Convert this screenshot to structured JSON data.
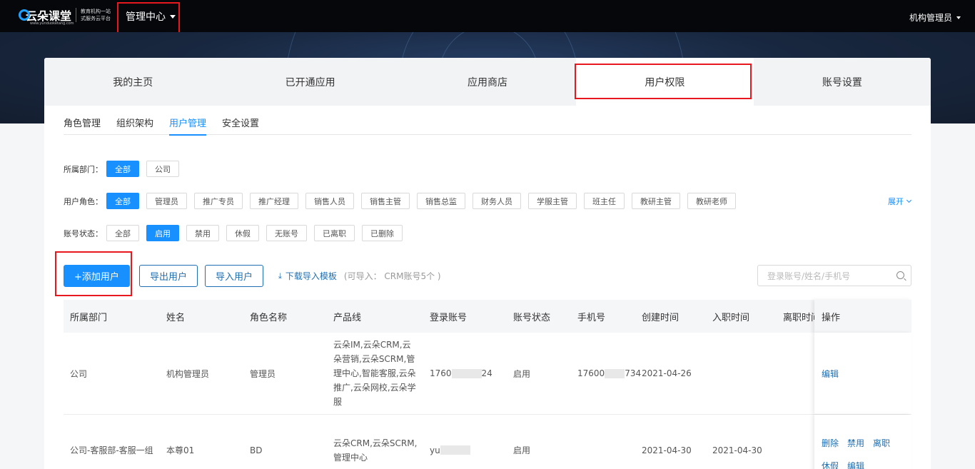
{
  "topbar": {
    "logo_title": "云朵课堂",
    "logo_url": "www.yunduoketang.com",
    "logo_slogan": "教育机构一站式服务云平台",
    "mgmt_center": "管理中心",
    "user": "机构管理员"
  },
  "main_tabs": [
    "我的主页",
    "已开通应用",
    "应用商店",
    "用户权限",
    "账号设置"
  ],
  "sub_tabs": [
    "角色管理",
    "组织架构",
    "用户管理",
    "安全设置"
  ],
  "filters": {
    "department": {
      "label": "所属部门：",
      "options": [
        "全部",
        "公司"
      ]
    },
    "role": {
      "label": "用户角色：",
      "options": [
        "全部",
        "管理员",
        "推广专员",
        "推广经理",
        "销售人员",
        "销售主管",
        "销售总监",
        "财务人员",
        "学服主管",
        "班主任",
        "教研主管",
        "教研老师"
      ]
    },
    "status": {
      "label": "账号状态：",
      "options": [
        "全部",
        "启用",
        "禁用",
        "休假",
        "无账号",
        "已离职",
        "已删除"
      ]
    },
    "expand": "展开"
  },
  "actions": {
    "add": "+添加用户",
    "export": "导出用户",
    "import": "导入用户",
    "download": "下载导入模板",
    "hint": "(可导入： CRM账号5个 )",
    "search_placeholder": "登录账号/姓名/手机号"
  },
  "table": {
    "headers": [
      "所属部门",
      "姓名",
      "角色名称",
      "产品线",
      "登录账号",
      "账号状态",
      "手机号",
      "创建时间",
      "入职时间",
      "离职时间",
      "操作"
    ],
    "rows": [
      {
        "dept": "公司",
        "name": "机构管理员",
        "role": "管理员",
        "product": "云朵IM,云朵CRM,云朵营销,云朵SCRM,管理中心,智能客服,云朵推广,云朵网校,云朵学服",
        "account_a": "1760",
        "account_b": "24",
        "status": "启用",
        "phone_a": "17600",
        "phone_b": "734",
        "created": "2021-04-26",
        "joined": "",
        "left": "",
        "ops": [
          "编辑"
        ]
      },
      {
        "dept": "公司-客服部-客服一组",
        "name": "本尊01",
        "role": "BD",
        "product": "云朵CRM,云朵SCRM,管理中心",
        "account_a": "yu",
        "account_b": "",
        "status": "启用",
        "phone_a": "",
        "phone_b": "",
        "created": "2021-04-30",
        "joined": "2021-04-30",
        "left": "",
        "ops": [
          "删除",
          "禁用",
          "离职",
          "休假",
          "编辑"
        ]
      }
    ]
  },
  "colors": {
    "primary": "#1890ff",
    "highlight": "#e8191e",
    "topbar": "#05070b"
  }
}
